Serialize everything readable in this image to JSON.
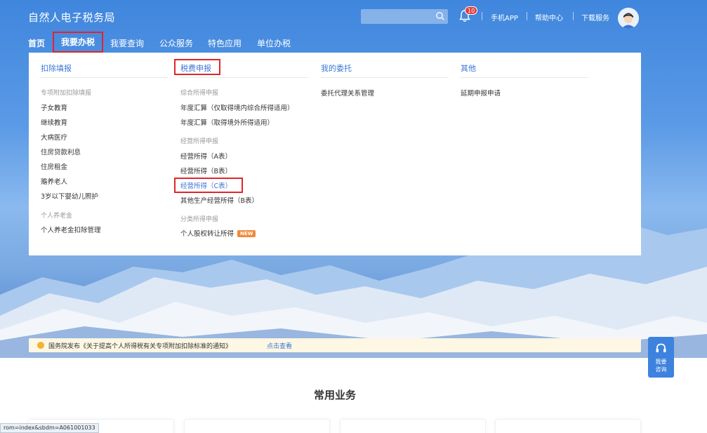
{
  "header": {
    "logo": "自然人电子税务局",
    "search_placeholder": "",
    "notification_count": "10",
    "links": [
      "手机APP",
      "帮助中心",
      "下载服务"
    ]
  },
  "nav": {
    "items": [
      "首页",
      "我要办税",
      "我要查询",
      "公众服务",
      "特色应用",
      "单位办税"
    ],
    "active_index": 1
  },
  "menu": {
    "columns": [
      {
        "title": "扣除填报",
        "groups": [
          {
            "label": "专项附加扣除填报",
            "items": [
              "子女教育",
              "继续教育",
              "大病医疗",
              "住房贷款利息",
              "住房租金",
              "赡养老人",
              "3岁以下婴幼儿照护"
            ]
          },
          {
            "label": "个人养老金",
            "items": [
              "个人养老金扣除管理"
            ]
          }
        ]
      },
      {
        "title": "税费申报",
        "groups": [
          {
            "label": "综合所得申报",
            "items": [
              "年度汇算（仅取得境内综合所得适用）",
              "年度汇算（取得境外所得适用）"
            ]
          },
          {
            "label": "经营所得申报",
            "items": [
              "经营所得（A表）",
              "经营所得（B表）",
              "经营所得（C表）",
              "其他生产经营所得（B表）"
            ]
          },
          {
            "label": "分类所得申报",
            "items": [
              "个人股权转让所得"
            ]
          }
        ],
        "new_tag": "NEW"
      },
      {
        "title": "我的委托",
        "groups": [
          {
            "label": "",
            "items": [
              "委托代理关系管理"
            ]
          }
        ]
      },
      {
        "title": "其他",
        "groups": [
          {
            "label": "",
            "items": [
              "延期申报申请"
            ]
          }
        ]
      }
    ]
  },
  "notice": {
    "text": "国务院发布《关于提高个人所得税有关专项附加扣除标准的通知》",
    "link": "点击查看"
  },
  "consult": {
    "line1": "我要",
    "line2": "咨询"
  },
  "section_title": "常用业务",
  "status_url": "rom=index&sbdm=A061001033",
  "colors": {
    "primary": "#3a76d6",
    "highlight_border": "#e0262b",
    "new_tag": "#f08a3a",
    "badge": "#e23b3b"
  }
}
